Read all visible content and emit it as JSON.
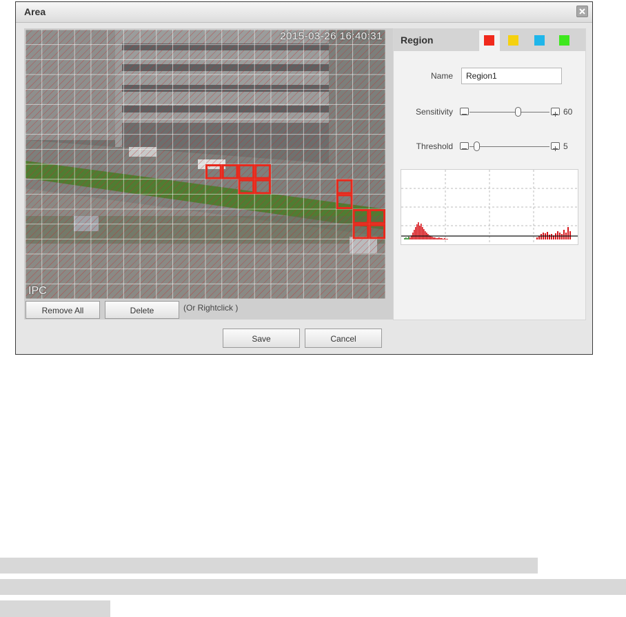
{
  "dialog": {
    "title": "Area",
    "close_icon": "close-icon"
  },
  "video": {
    "timestamp": "2015-03-26 16:40:31",
    "osd_label": "IPC",
    "grid": {
      "color": "#c8262a",
      "cols": 22,
      "rows": 18
    },
    "highlight_color": "#e8291c"
  },
  "toolbar": {
    "remove_all_label": "Remove All",
    "delete_label": "Delete",
    "hint": "(Or Rightclick )"
  },
  "region": {
    "title": "Region",
    "swatches": [
      {
        "name": "red",
        "color": "#f0291c",
        "selected": true
      },
      {
        "name": "yellow",
        "color": "#f5d10f",
        "selected": false
      },
      {
        "name": "blue",
        "color": "#1fb6ea",
        "selected": false
      },
      {
        "name": "green",
        "color": "#3ee81e",
        "selected": false
      }
    ],
    "name_label": "Name",
    "name_value": "Region1",
    "sensitivity_label": "Sensitivity",
    "sensitivity_value": "60",
    "sensitivity_fraction": 0.6,
    "threshold_label": "Threshold",
    "threshold_value": "5",
    "threshold_fraction": 0.05,
    "graph": {
      "bar_color": "#d7161c",
      "low_color": "#2e8b2e",
      "line_color": "#111"
    }
  },
  "footer": {
    "save_label": "Save",
    "cancel_label": "Cancel"
  }
}
